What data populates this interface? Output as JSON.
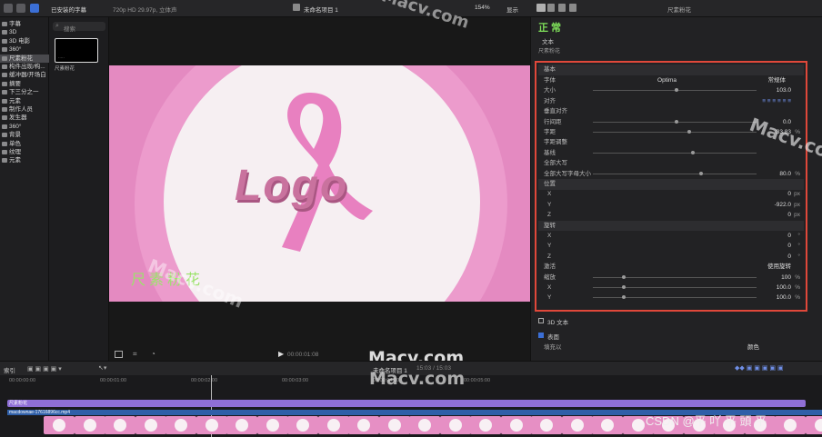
{
  "topbar": {
    "library_label": "已安装的字幕",
    "format": "720p HD 29.97p, 立体声",
    "project_title": "未命名项目 1",
    "zoom": "154%",
    "display_menu": "显示",
    "inspector_title": "尺素粉花"
  },
  "sidebar": {
    "items": [
      {
        "label": "字幕"
      },
      {
        "label": "3D"
      },
      {
        "label": "3D 电影"
      },
      {
        "label": "360°"
      },
      {
        "label": "尺素粉花"
      },
      {
        "label": "构件出现/构..."
      },
      {
        "label": "缓冲器/开场白"
      },
      {
        "label": "摘要"
      },
      {
        "label": "下三分之一"
      },
      {
        "label": "元素"
      },
      {
        "label": "制作人员"
      },
      {
        "label": "发生器"
      },
      {
        "label": "360°"
      },
      {
        "label": "背景"
      },
      {
        "label": "单色"
      },
      {
        "label": "纹理"
      },
      {
        "label": "元素"
      }
    ]
  },
  "browser": {
    "search_placeholder": "搜索",
    "clip_label": "尺素粉花"
  },
  "viewer": {
    "logo_text": "Logo",
    "caption": "尺素粉花",
    "timecode": "00:00:01:08",
    "timecode_big": "1:08"
  },
  "inspector": {
    "big_title": "正 常",
    "text_label": "文本",
    "text_value": "尺素粉花",
    "basic_header": "基本",
    "rows": [
      {
        "label": "字体",
        "value": "Optima",
        "extra": "常规体"
      },
      {
        "label": "大小",
        "value": "103.0"
      },
      {
        "label": "对齐",
        "value": ""
      },
      {
        "label": "垂直对齐",
        "value": ""
      },
      {
        "label": "行间距",
        "value": "0.0"
      },
      {
        "label": "字距",
        "value": "33.83",
        "unit": "%"
      },
      {
        "label": "字距调整",
        "value": ""
      },
      {
        "label": "基线",
        "value": ""
      },
      {
        "label": "全部大写",
        "value": ""
      },
      {
        "label": "全部大写字母大小",
        "value": "80.0",
        "unit": "%"
      },
      {
        "label": "位置",
        "value": ""
      },
      {
        "label": "X",
        "value": "0",
        "unit": "px"
      },
      {
        "label": "Y",
        "value": "-922.0",
        "unit": "px"
      },
      {
        "label": "Z",
        "value": "0",
        "unit": "px"
      },
      {
        "label": "旋转",
        "value": ""
      },
      {
        "label": "X",
        "value": "0",
        "unit": "°"
      },
      {
        "label": "Y",
        "value": "0",
        "unit": "°"
      },
      {
        "label": "Z",
        "value": "0",
        "unit": "°"
      },
      {
        "label": "激活",
        "value": "使用旋转"
      },
      {
        "label": "缩放",
        "value": "100",
        "unit": "%"
      },
      {
        "label": "X",
        "value": "100.0",
        "unit": "%"
      },
      {
        "label": "Y",
        "value": "100.0",
        "unit": "%"
      }
    ],
    "text3d_label": "3D 文本",
    "surface_label": "表面",
    "fill_label": "填充以",
    "fill_value": "颜色"
  },
  "timeline": {
    "index_label": "索引",
    "project_label": "未命名项目 1",
    "duration": "15:03 / 15:03",
    "clip_title": "尺素粉花",
    "clip_file": "macdownae-17616896cc.mp4",
    "ruler": [
      "00:00:00:00",
      "00:00:01:00",
      "00:00:02:00",
      "00:00:03:00",
      "00:00:04:00",
      "00:00:05:00"
    ]
  },
  "watermarks": {
    "macv_big": "Macv.com",
    "macv_small": "Macv.com",
    "csdn": "CSDN @平 吖 平 頭 平"
  },
  "colors": {
    "pink": "#e68fc4",
    "red_box": "#e0483a",
    "purple_bar": "#8f6fd6"
  }
}
